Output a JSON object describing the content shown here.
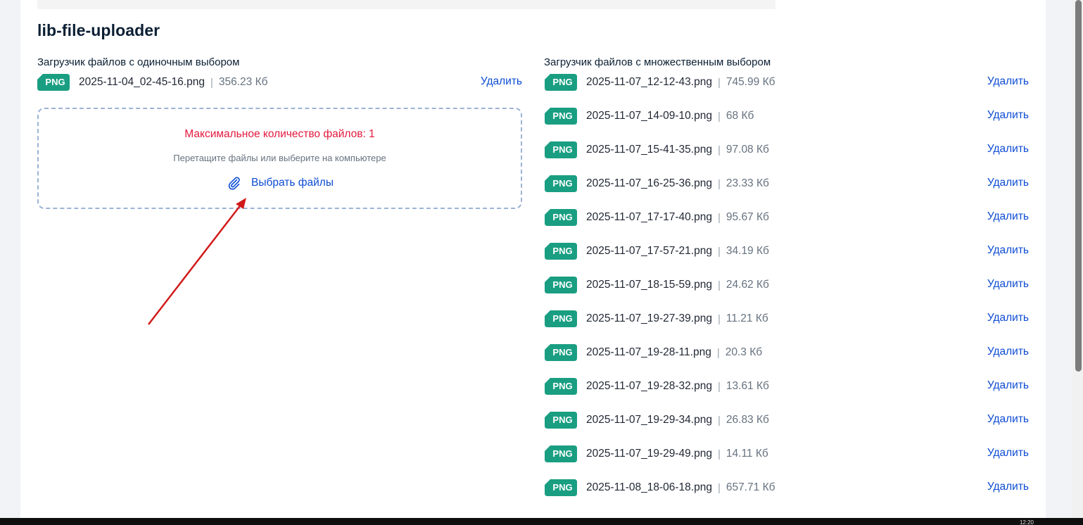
{
  "page": {
    "title": "lib-file-uploader"
  },
  "single_uploader": {
    "title": "Загрузчик файлов с одиночным выбором",
    "file": {
      "type": "PNG",
      "name": "2025-11-04_02-45-16.png",
      "size": "356.23 Кб",
      "delete_label": "Удалить"
    },
    "dropzone": {
      "error": "Максимальное количество файлов: 1",
      "hint": "Перетащите файлы или выберите на компьютере",
      "pick_label": "Выбрать файлы"
    }
  },
  "multi_uploader": {
    "title": "Загрузчик файлов с множественным выбором",
    "delete_label": "Удалить",
    "files": [
      {
        "type": "PNG",
        "name": "2025-11-07_12-12-43.png",
        "size": "745.99 Кб"
      },
      {
        "type": "PNG",
        "name": "2025-11-07_14-09-10.png",
        "size": "68 Кб"
      },
      {
        "type": "PNG",
        "name": "2025-11-07_15-41-35.png",
        "size": "97.08 Кб"
      },
      {
        "type": "PNG",
        "name": "2025-11-07_16-25-36.png",
        "size": "23.33 Кб"
      },
      {
        "type": "PNG",
        "name": "2025-11-07_17-17-40.png",
        "size": "95.67 Кб"
      },
      {
        "type": "PNG",
        "name": "2025-11-07_17-57-21.png",
        "size": "34.19 Кб"
      },
      {
        "type": "PNG",
        "name": "2025-11-07_18-15-59.png",
        "size": "24.62 Кб"
      },
      {
        "type": "PNG",
        "name": "2025-11-07_19-27-39.png",
        "size": "11.21 Кб"
      },
      {
        "type": "PNG",
        "name": "2025-11-07_19-28-11.png",
        "size": "20.3 Кб"
      },
      {
        "type": "PNG",
        "name": "2025-11-07_19-28-32.png",
        "size": "13.61 Кб"
      },
      {
        "type": "PNG",
        "name": "2025-11-07_19-29-34.png",
        "size": "26.83 Кб"
      },
      {
        "type": "PNG",
        "name": "2025-11-07_19-29-49.png",
        "size": "14.11 Кб"
      },
      {
        "type": "PNG",
        "name": "2025-11-08_18-06-18.png",
        "size": "657.71 Кб"
      }
    ]
  },
  "colors": {
    "badge": "#1a9e82",
    "link": "#0d4cd3",
    "error": "#e1193c",
    "annotation_arrow": "#d11a1a"
  },
  "icons": {
    "pick": "paperclip-icon"
  },
  "taskbar": {
    "clock": "12:20"
  }
}
